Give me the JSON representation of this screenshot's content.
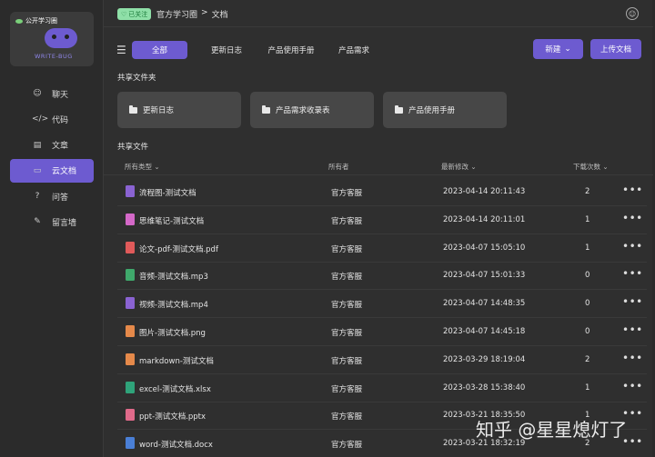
{
  "logo": {
    "top_text": "公开学习圈",
    "text": "WRITE-BUG"
  },
  "sidebar": {
    "items": [
      {
        "label": "聊天",
        "icon": "chat-icon",
        "glyph": "☺",
        "active": false
      },
      {
        "label": "代码",
        "icon": "code-icon",
        "glyph": "</>",
        "active": false
      },
      {
        "label": "文章",
        "icon": "article-icon",
        "glyph": "▤",
        "active": false
      },
      {
        "label": "云文档",
        "icon": "folder-icon",
        "glyph": "▭",
        "active": true
      },
      {
        "label": "问答",
        "icon": "question-icon",
        "glyph": "?",
        "active": false
      },
      {
        "label": "留言墙",
        "icon": "edit-icon",
        "glyph": "✎",
        "active": false
      }
    ]
  },
  "topbar": {
    "follow_badge": "已关注",
    "breadcrumb": [
      "官方学习圈",
      "文档"
    ],
    "separator": ">"
  },
  "tabs": [
    "全部",
    "更新日志",
    "产品使用手册",
    "产品需求"
  ],
  "buttons": {
    "new": "新建",
    "upload": "上传文档"
  },
  "shared_folders_title": "共享文件夹",
  "folders": [
    "更新日志",
    "产品需求收录表",
    "产品使用手册"
  ],
  "shared_files_title": "共享文件",
  "table": {
    "headers": {
      "type": "所有类型",
      "owner": "所有者",
      "modified": "最新修改",
      "downloads": "下载次数"
    },
    "rows": [
      {
        "name": "流程图-测试文档",
        "owner": "官方客服",
        "modified": "2023-04-14 20:11:43",
        "downloads": "2",
        "color": "#8a63d2"
      },
      {
        "name": "思维笔记-测试文档",
        "owner": "官方客服",
        "modified": "2023-04-14 20:11:01",
        "downloads": "1",
        "color": "#d468c8"
      },
      {
        "name": "论文-pdf-测试文档.pdf",
        "owner": "官方客服",
        "modified": "2023-04-07 15:05:10",
        "downloads": "1",
        "color": "#e05a5a"
      },
      {
        "name": "音频-测试文档.mp3",
        "owner": "官方客服",
        "modified": "2023-04-07 15:01:33",
        "downloads": "0",
        "color": "#3fa86b"
      },
      {
        "name": "视频-测试文档.mp4",
        "owner": "官方客服",
        "modified": "2023-04-07 14:48:35",
        "downloads": "0",
        "color": "#8a63d2"
      },
      {
        "name": "图片-测试文档.png",
        "owner": "官方客服",
        "modified": "2023-04-07 14:45:18",
        "downloads": "0",
        "color": "#e5894a"
      },
      {
        "name": "markdown-测试文档",
        "owner": "官方客服",
        "modified": "2023-03-29 18:19:04",
        "downloads": "2",
        "color": "#e5894a"
      },
      {
        "name": "excel-测试文档.xlsx",
        "owner": "官方客服",
        "modified": "2023-03-28 15:38:40",
        "downloads": "1",
        "color": "#2fa37a"
      },
      {
        "name": "ppt-测试文档.pptx",
        "owner": "官方客服",
        "modified": "2023-03-21 18:35:50",
        "downloads": "1",
        "color": "#e06a8a"
      },
      {
        "name": "word-测试文档.docx",
        "owner": "官方客服",
        "modified": "2023-03-21 18:32:19",
        "downloads": "2",
        "color": "#4a7fd6"
      }
    ]
  },
  "watermark": "知乎 @星星熄灯了",
  "accent_color": "#6d5bd0"
}
